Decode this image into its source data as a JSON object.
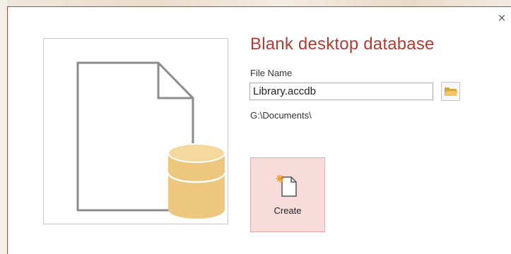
{
  "dialog": {
    "title": "Blank desktop database",
    "close_label": "×"
  },
  "file_name": {
    "label": "File Name",
    "value": "Library.accdb"
  },
  "location": {
    "path": "G:\\Documents\\"
  },
  "create_button": {
    "label": "Create"
  },
  "icons": {
    "close": "close-icon",
    "browse": "folder-icon",
    "create": "new-document-icon",
    "preview": "database-document-illustration"
  },
  "colors": {
    "title": "#b23b32",
    "create_button_bg": "#f8dcdc",
    "create_button_border": "#e9a9a6",
    "database_cylinder": "#edc77e",
    "folder": "#e8b94a"
  }
}
